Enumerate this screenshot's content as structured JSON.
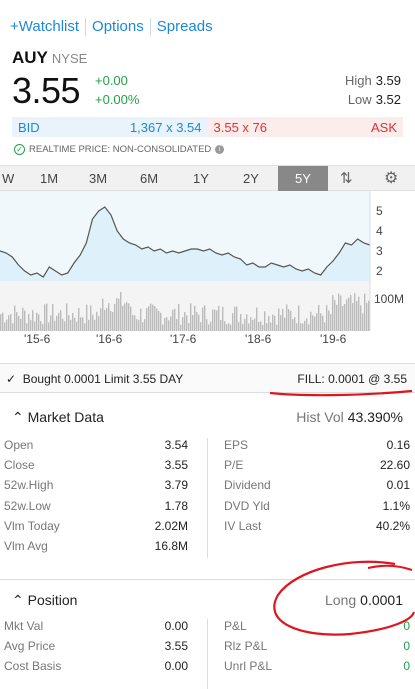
{
  "nav": {
    "watchlist": "+Watchlist",
    "options": "Options",
    "spreads": "Spreads"
  },
  "quote": {
    "symbol": "AUY",
    "exchange": "NYSE",
    "price": "3.55",
    "change": "+0.00",
    "change_pct": "+0.00%",
    "high_label": "High",
    "high": "3.59",
    "low_label": "Low",
    "low": "3.52",
    "bid_label": "BID",
    "bid_value": "1,367 x 3.54",
    "ask_value": "3.55 x 76",
    "ask_label": "ASK",
    "realtime": "REALTIME PRICE: NON-CONSOLIDATED"
  },
  "ranges": {
    "items": [
      "W",
      "1M",
      "3M",
      "6M",
      "1Y",
      "2Y",
      "5Y"
    ],
    "active": "5Y"
  },
  "chart_data": {
    "type": "line",
    "x_ticks": [
      "'15-6",
      "'16-6",
      "'17-6",
      "'18-6",
      "'19-6"
    ],
    "y_ticks": [
      "5",
      "4",
      "3",
      "2"
    ],
    "volume_label": "100M",
    "price_series": [
      3.2,
      3.1,
      2.9,
      2.5,
      2.2,
      2.0,
      2.1,
      1.9,
      2.4,
      2.2,
      2.0,
      2.1,
      2.6,
      3.0,
      3.6,
      4.8,
      5.2,
      5.4,
      5.0,
      4.2,
      3.8,
      3.6,
      3.5,
      3.3,
      3.4,
      3.2,
      3.3,
      3.1,
      3.2,
      3.1,
      3.2,
      3.3,
      3.3,
      3.2,
      3.3,
      3.1,
      3.0,
      3.1,
      2.9,
      2.8,
      2.5,
      2.6,
      2.4,
      2.4,
      2.6,
      2.5,
      2.4,
      2.5,
      2.3,
      2.2,
      2.3,
      2.1,
      2.0,
      2.4,
      2.7,
      3.1,
      3.6,
      3.5,
      3.8,
      3.6,
      3.5
    ]
  },
  "order": {
    "bought": "Bought 0.0001 Limit 3.55 DAY",
    "fill": "FILL: 0.0001 @ 3.55"
  },
  "market_data": {
    "title": "Market Data",
    "hist_vol_label": "Hist Vol",
    "hist_vol": "43.390%",
    "left": [
      {
        "label": "Open",
        "value": "3.54"
      },
      {
        "label": "Close",
        "value": "3.55"
      },
      {
        "label": "52w.High",
        "value": "3.79"
      },
      {
        "label": "52w.Low",
        "value": "1.78"
      },
      {
        "label": "Vlm Today",
        "value": "2.02M"
      },
      {
        "label": "Vlm Avg",
        "value": "16.8M"
      }
    ],
    "right": [
      {
        "label": "EPS",
        "value": "0.16"
      },
      {
        "label": "P/E",
        "value": "22.60"
      },
      {
        "label": "Dividend",
        "value": "0.01"
      },
      {
        "label": "DVD Yld",
        "value": "1.1%"
      },
      {
        "label": "IV Last",
        "value": "40.2%"
      }
    ]
  },
  "position": {
    "title": "Position",
    "side_label": "Long",
    "qty": "0.0001",
    "left": [
      {
        "label": "Mkt Val",
        "value": "0.00"
      },
      {
        "label": "Avg Price",
        "value": "3.55"
      },
      {
        "label": "Cost Basis",
        "value": "0.00"
      }
    ],
    "right": [
      {
        "label": "P&L",
        "value": "0"
      },
      {
        "label": "Rlz P&L",
        "value": "0"
      },
      {
        "label": "Unrl P&L",
        "value": "0"
      }
    ]
  },
  "colors": {
    "accent": "#1e88d6",
    "up": "#22a047",
    "ask": "#d33333",
    "annotation": "#e0141e"
  }
}
